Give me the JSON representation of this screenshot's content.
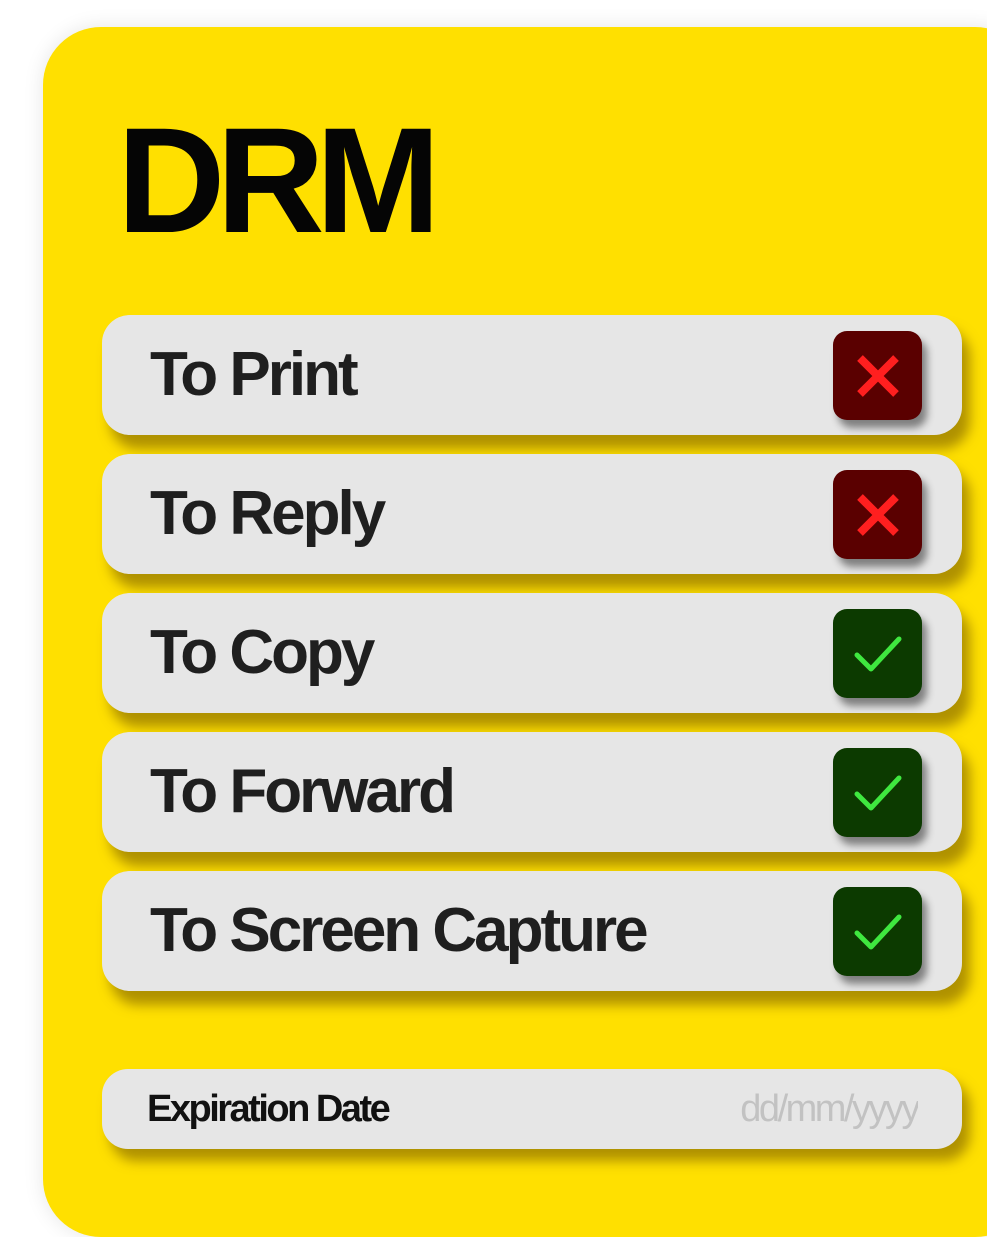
{
  "drm": {
    "title": "DRM",
    "permissions": [
      {
        "label": "To Print",
        "allowed": false,
        "status_icon": "x-icon"
      },
      {
        "label": "To Reply",
        "allowed": false,
        "status_icon": "x-icon"
      },
      {
        "label": "To Copy",
        "allowed": true,
        "status_icon": "check-icon"
      },
      {
        "label": "To Forward",
        "allowed": true,
        "status_icon": "check-icon"
      },
      {
        "label": "To Screen Capture",
        "allowed": true,
        "status_icon": "check-icon"
      }
    ],
    "expiration": {
      "label": "Expiration Date",
      "value": "",
      "placeholder": "dd/mm/yyyy"
    }
  },
  "colors": {
    "panel_background": "#ffe000",
    "row_background": "#e6e6e6",
    "denied_background": "#5a0000",
    "denied_mark": "#ff1f1f",
    "allowed_background": "#0c3a00",
    "allowed_mark": "#3fe83f",
    "placeholder_text": "#c2c2c2"
  }
}
